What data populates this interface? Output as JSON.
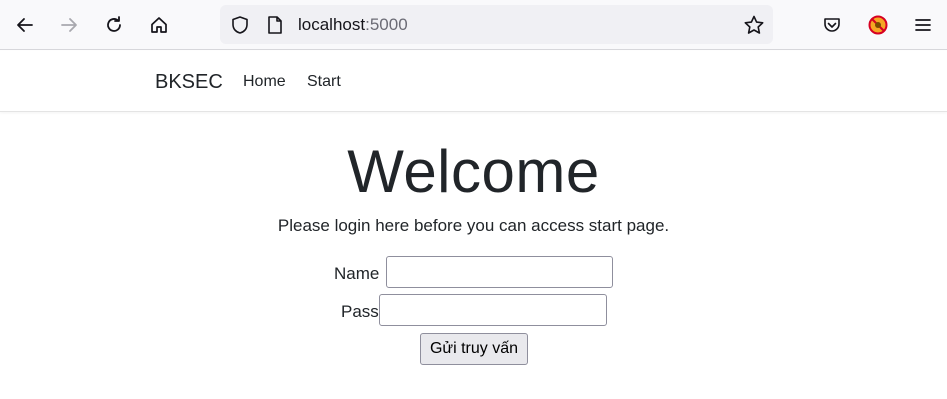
{
  "browser": {
    "url_host": "localhost",
    "url_port": ":5000",
    "icons": [
      "back-icon",
      "forward-icon",
      "reload-icon",
      "home-icon",
      "shield-icon",
      "page-icon",
      "star-icon",
      "pocket-icon",
      "extension-icon",
      "menu-icon"
    ]
  },
  "navbar": {
    "brand": "BKSEC",
    "links": [
      "Home",
      "Start"
    ]
  },
  "main": {
    "title": "Welcome",
    "lead": "Please login here before you can access start page.",
    "form": {
      "name_label": "Name",
      "name_value": "",
      "pass_label": "Pass",
      "pass_value": "",
      "submit_label": "Gửi truy vấn"
    }
  },
  "colors": {
    "toolbar_bg": "#f9f9fb",
    "urlbar_bg": "#f0f0f4",
    "text": "#212529",
    "button_bg": "#e9e9ed"
  }
}
